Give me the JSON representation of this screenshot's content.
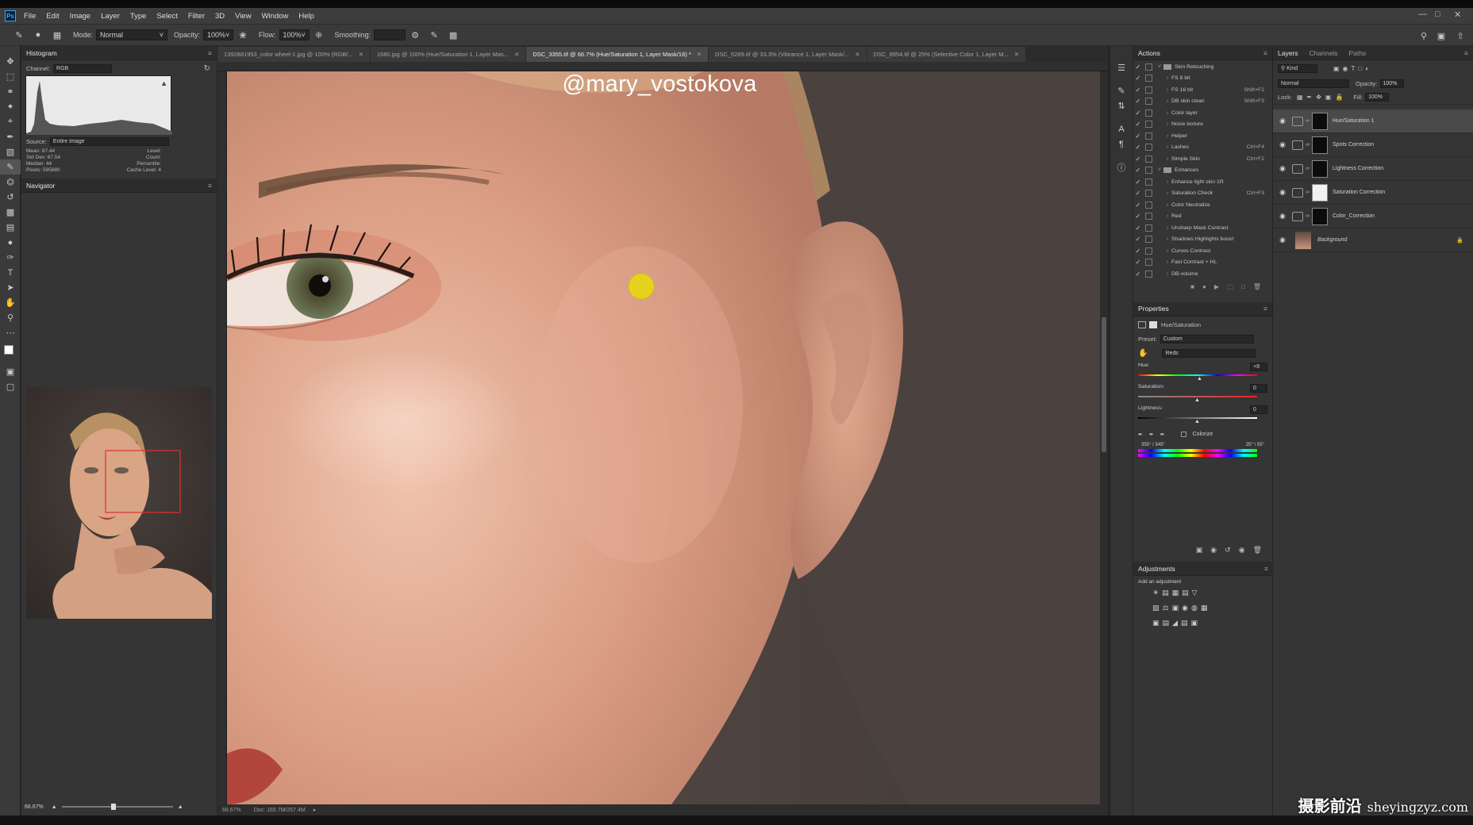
{
  "menu": [
    "File",
    "Edit",
    "Image",
    "Layer",
    "Type",
    "Select",
    "Filter",
    "3D",
    "View",
    "Window",
    "Help"
  ],
  "app_logo": "Ps",
  "options": {
    "mode_label": "Mode:",
    "mode_value": "Normal",
    "opacity_label": "Opacity:",
    "opacity_value": "100%",
    "flow_label": "Flow:",
    "flow_value": "100%",
    "smoothing_label": "Smoothing:"
  },
  "doc_tabs": [
    {
      "label": "1392881953_color wheel-1.jpg @ 100% (RGB/...",
      "active": false
    },
    {
      "label": "1680.jpg @ 100% (Hue/Saturation 1, Layer Mas...",
      "active": false
    },
    {
      "label": "DSC_3355.tif @ 66.7% (Hue/Saturation 1, Layer Mask/16) *",
      "active": true
    },
    {
      "label": "DSC_5289.tif @ 33.3% (Vibrance 1, Layer Mask/...",
      "active": false
    },
    {
      "label": "DSC_8954.tif @ 25% (Selective Color 1, Layer M...",
      "active": false
    }
  ],
  "histogram": {
    "title": "Histogram",
    "channel_label": "Channel:",
    "channel_value": "RGB",
    "source_label": "Source:",
    "source_value": "Entire Image",
    "stats_left": [
      [
        "Mean:",
        "87.44"
      ],
      [
        "Std Dev:",
        "67.54"
      ],
      [
        "Median:",
        "44"
      ],
      [
        "Pixels:",
        "595680"
      ]
    ],
    "stats_right": [
      [
        "Level:",
        ""
      ],
      [
        "Count:",
        ""
      ],
      [
        "Percentile:",
        ""
      ],
      [
        "Cache Level:",
        "4"
      ]
    ]
  },
  "navigator": {
    "title": "Navigator",
    "zoom": "66.67%"
  },
  "canvas": {
    "watermark_handle": "@mary_vostokova"
  },
  "status": {
    "zoom": "66.67%",
    "doc": "Doc: 165.7M/257.4M"
  },
  "actions": {
    "title": "Actions",
    "rows": [
      {
        "label": "Skin Retouching",
        "folder": true,
        "shortcut": "",
        "indent": 0
      },
      {
        "label": "FS 8 bit",
        "folder": false,
        "shortcut": "",
        "indent": 1
      },
      {
        "label": "FS 16 bit",
        "folder": false,
        "shortcut": "Shift+F2",
        "indent": 1
      },
      {
        "label": "DB skin clean",
        "folder": false,
        "shortcut": "Shift+F3",
        "indent": 1
      },
      {
        "label": "Color layer",
        "folder": false,
        "shortcut": "",
        "indent": 1
      },
      {
        "label": "Noise texture",
        "folder": false,
        "shortcut": "",
        "indent": 1
      },
      {
        "label": "Helper",
        "folder": false,
        "shortcut": "",
        "indent": 1
      },
      {
        "label": "Lashes",
        "folder": false,
        "shortcut": "Ctrl+F4",
        "indent": 1
      },
      {
        "label": "Simple Skin",
        "folder": false,
        "shortcut": "Ctrl+F2",
        "indent": 1
      },
      {
        "label": "Enhances",
        "folder": true,
        "shortcut": "",
        "indent": 0
      },
      {
        "label": "Enhance light skin 1R",
        "folder": false,
        "shortcut": "",
        "indent": 1
      },
      {
        "label": "Saturation Check",
        "folder": false,
        "shortcut": "Ctrl+F3",
        "indent": 1
      },
      {
        "label": "Color Neutralize",
        "folder": false,
        "shortcut": "",
        "indent": 1
      },
      {
        "label": "Red",
        "folder": false,
        "shortcut": "",
        "indent": 1
      },
      {
        "label": "Unsharp Mask Contrast",
        "folder": false,
        "shortcut": "",
        "indent": 1
      },
      {
        "label": "Shadows Highlights boost",
        "folder": false,
        "shortcut": "",
        "indent": 1
      },
      {
        "label": "Curves Contrast",
        "folder": false,
        "shortcut": "",
        "indent": 1
      },
      {
        "label": "Fast Contrast + HL",
        "folder": false,
        "shortcut": "",
        "indent": 1
      },
      {
        "label": "DB-volume",
        "folder": false,
        "shortcut": "",
        "indent": 1
      }
    ]
  },
  "properties": {
    "title": "Properties",
    "type_label": "Hue/Saturation",
    "preset_label": "Preset:",
    "preset_value": "Custom",
    "range_value": "Reds",
    "hue_label": "Hue:",
    "hue_value": "+8",
    "hue_pos": 0.52,
    "sat_label": "Saturation:",
    "sat_value": "0",
    "sat_pos": 0.5,
    "light_label": "Lightness:",
    "light_value": "0",
    "light_pos": 0.5,
    "colorize_label": "Colorize",
    "range_left": "355° / 345°",
    "range_right": "25° \\ 55°"
  },
  "adjustments": {
    "title": "Adjustments",
    "hint": "Add an adjustment"
  },
  "layers": {
    "tabs": [
      "Layers",
      "Channels",
      "Paths"
    ],
    "kind_label": "Kind",
    "blend_value": "Normal",
    "opacity_label": "Opacity:",
    "opacity_value": "100%",
    "lock_label": "Lock:",
    "fill_label": "Fill:",
    "fill_value": "100%",
    "items": [
      {
        "name": "Hue/Saturation 1",
        "selected": true,
        "mask": "black",
        "type": "adj"
      },
      {
        "name": "Spots Correction",
        "selected": false,
        "mask": "black",
        "type": "adj"
      },
      {
        "name": "Lightness Correction",
        "selected": false,
        "mask": "black",
        "type": "adj"
      },
      {
        "name": "Saturation Correction",
        "selected": false,
        "mask": "white",
        "type": "adj"
      },
      {
        "name": "Color_Correction",
        "selected": false,
        "mask": "black",
        "type": "adj"
      },
      {
        "name": "Background",
        "selected": false,
        "mask": "",
        "type": "bg"
      }
    ]
  },
  "watermark_site": {
    "cn": "摄影前沿",
    "domain": "sheyingzyz.com"
  },
  "colors": {
    "yellow_dot": "#e6d21e",
    "selection_rect": "#e03030",
    "accent": "#31a8ff"
  }
}
